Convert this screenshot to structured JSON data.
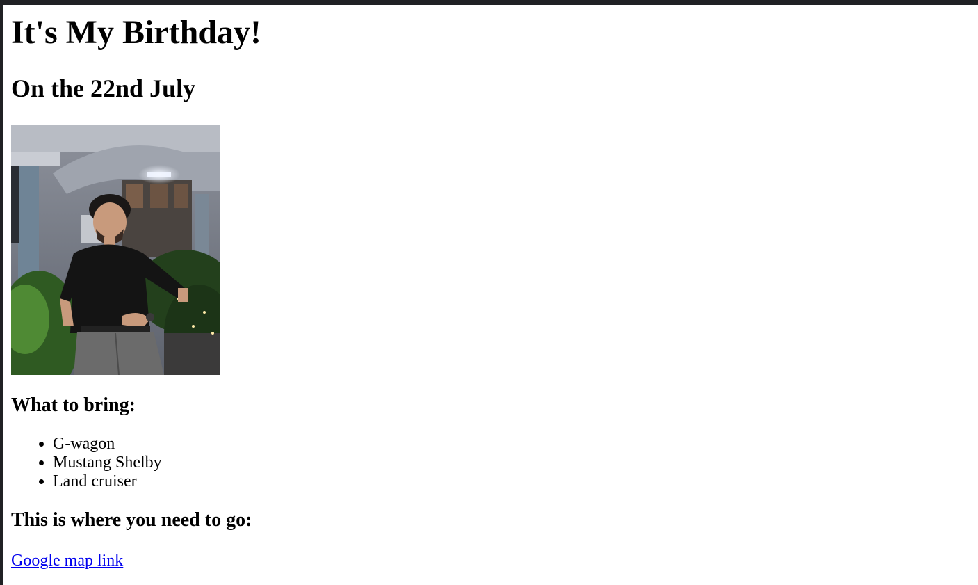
{
  "page": {
    "title": "It's My Birthday!",
    "subtitle": "On the 22nd July",
    "bring_heading": "What to bring:",
    "bring_items": [
      "G-wagon",
      "Mustang Shelby",
      "Land cruiser"
    ],
    "where_heading": "This is where you need to go:",
    "map_link_text": "Google map link"
  },
  "colors": {
    "link": "#0000ee",
    "window_frame": "#202124"
  }
}
